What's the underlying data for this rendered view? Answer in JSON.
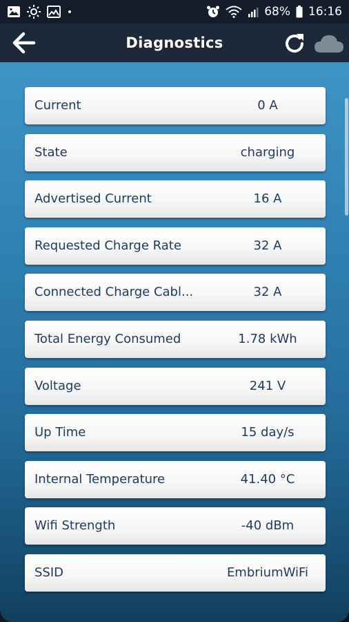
{
  "status_bar": {
    "battery_percent": "68%",
    "time": "16:16",
    "icons": [
      "gallery-icon",
      "brightness-icon",
      "image-icon",
      "dot-icon",
      "alarm-icon",
      "wifi-icon",
      "signal-icon",
      "battery-icon"
    ]
  },
  "app_bar": {
    "title": "Diagnostics",
    "back_icon": "back-arrow-icon",
    "refresh_icon": "refresh-icon",
    "cloud_icon": "cloud-icon"
  },
  "colors": {
    "status_bar_bg": "#141c2a",
    "app_bar_bg": "#1d2838",
    "content_gradient_top": "#3f93c6",
    "content_gradient_bottom": "#123f5e",
    "row_text": "#1f3a63",
    "cloud_icon": "#7f8a97"
  },
  "diagnostics": [
    {
      "label": "Current",
      "value": "0 A"
    },
    {
      "label": "State",
      "value": "charging"
    },
    {
      "label": "Advertised Current",
      "value": "16 A"
    },
    {
      "label": "Requested Charge Rate",
      "value": "32 A"
    },
    {
      "label": "Connected Charge Cabl...",
      "value": "32 A"
    },
    {
      "label": "Total Energy Consumed",
      "value": "1.78 kWh"
    },
    {
      "label": "Voltage",
      "value": "241 V"
    },
    {
      "label": "Up Time",
      "value": "15 day/s"
    },
    {
      "label": "Internal Temperature",
      "value": "41.40 °C"
    },
    {
      "label": "Wifi Strength",
      "value": "-40 dBm"
    },
    {
      "label": "SSID",
      "value": "EmbriumWiFi"
    }
  ]
}
